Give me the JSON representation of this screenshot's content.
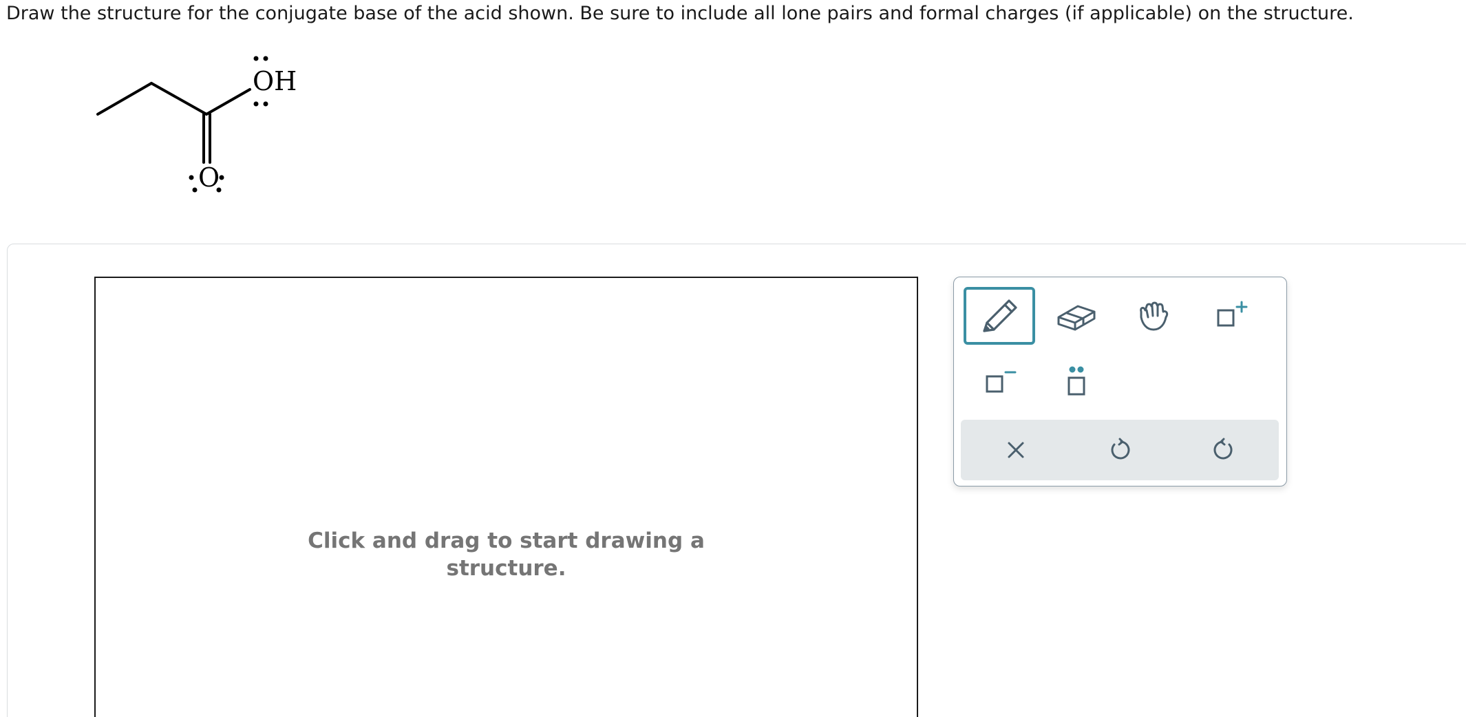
{
  "question": {
    "text": "Draw the structure for the conjugate base of the acid shown. Be sure to include all lone pairs and formal charges (if applicable) on the structure."
  },
  "molecule": {
    "hydroxyl_label": "OH",
    "carbonyl_label": "O"
  },
  "canvas": {
    "hint_line1": "Click and drag to start drawing a",
    "hint_line2": "structure."
  },
  "toolbar": {
    "tools": [
      {
        "name": "pencil-tool",
        "icon": "pencil-icon",
        "selected": true
      },
      {
        "name": "eraser-tool",
        "icon": "eraser-icon",
        "selected": false
      },
      {
        "name": "move-tool",
        "icon": "hand-icon",
        "selected": false
      },
      {
        "name": "positive-charge-tool",
        "icon": "positive-charge-icon",
        "selected": false
      },
      {
        "name": "negative-charge-tool",
        "icon": "negative-charge-icon",
        "selected": false
      },
      {
        "name": "lone-pair-tool",
        "icon": "lone-pair-icon",
        "selected": false
      }
    ],
    "actions": [
      {
        "name": "clear",
        "icon": "close-icon"
      },
      {
        "name": "undo",
        "icon": "undo-icon"
      },
      {
        "name": "redo",
        "icon": "redo-icon"
      }
    ]
  },
  "colors": {
    "accent": "#3a8fa3",
    "icon": "#4a5f6d",
    "action_bar": "#e4e8ea",
    "hint_text": "#757575"
  }
}
